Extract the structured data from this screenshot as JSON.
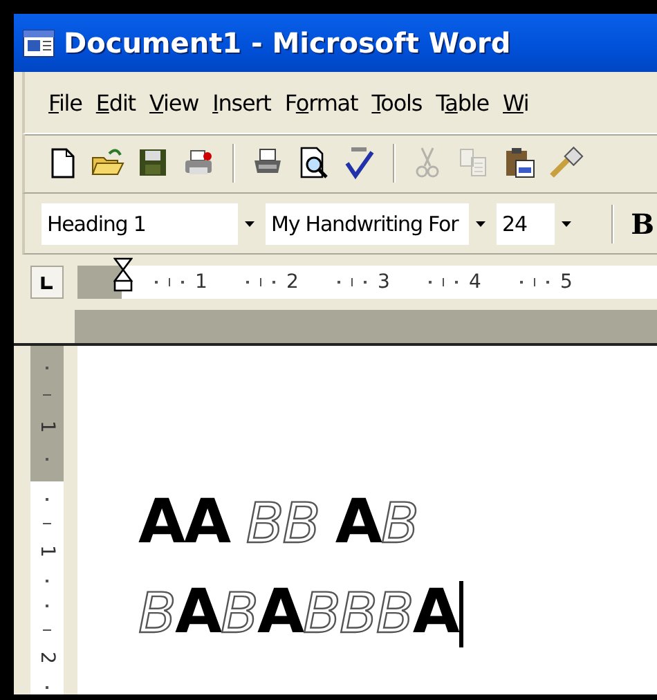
{
  "window": {
    "title": "Document1 - Microsoft Word"
  },
  "menu": [
    {
      "access_key": "F",
      "after": "ile"
    },
    {
      "access_key": "E",
      "after": "dit"
    },
    {
      "access_key": "V",
      "after": "iew"
    },
    {
      "access_key": "I",
      "after": "nsert"
    },
    {
      "before": "F",
      "access_key": "o",
      "after": "rmat"
    },
    {
      "access_key": "T",
      "after": "ools"
    },
    {
      "before": "T",
      "access_key": "a",
      "after": "ble"
    },
    {
      "access_key": "W",
      "after": "i"
    }
  ],
  "toolbar": [
    {
      "kind": "new",
      "disabled": false
    },
    {
      "kind": "open",
      "disabled": false
    },
    {
      "kind": "save",
      "disabled": false
    },
    {
      "kind": "permission",
      "disabled": false
    },
    {
      "kind": "separator"
    },
    {
      "kind": "print",
      "disabled": false
    },
    {
      "kind": "preview",
      "disabled": false
    },
    {
      "kind": "spelling",
      "disabled": false
    },
    {
      "kind": "separator"
    },
    {
      "kind": "cut",
      "disabled": true
    },
    {
      "kind": "copy",
      "disabled": true
    },
    {
      "kind": "paste",
      "disabled": false
    },
    {
      "kind": "painter",
      "disabled": false
    }
  ],
  "formatting": {
    "style": "Heading 1",
    "font": "My Handwriting For",
    "size": "24",
    "bold_button": "B"
  },
  "ruler": {
    "numbers": [
      "1",
      "2",
      "3",
      "4",
      "5"
    ]
  },
  "vertical_ruler": {
    "numbers": [
      "1",
      "1",
      "2"
    ]
  },
  "document": {
    "lines": [
      "**AA** BB **A**B",
      "B**A**B**A**BBB**A**"
    ]
  }
}
